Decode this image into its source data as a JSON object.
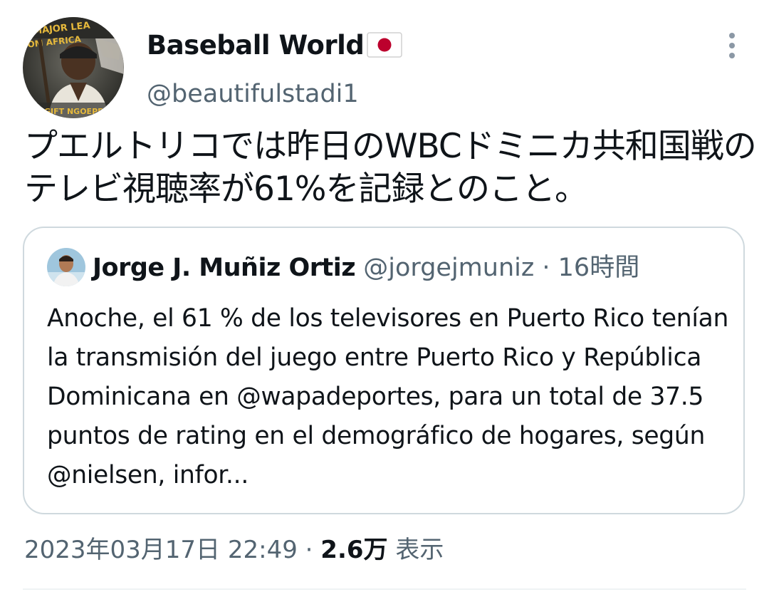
{
  "tweet": {
    "author": {
      "display_name": "Baseball World",
      "flag_icon": "japan-flag-icon",
      "handle": "@beautifulstadi1",
      "avatar_icon": "baseball-player-avatar"
    },
    "text": "プエルトリコでは昨日のWBCドミニカ共和国戦のテレビ視聴率が61%を記録とのこと。",
    "timestamp": "2023年03月17日 22:49",
    "separator": "·",
    "views_count": "2.6万",
    "views_label": "表示"
  },
  "quoted_tweet": {
    "display_name": "Jorge J. Muñiz Ortiz",
    "handle": "@jorgejmuniz",
    "separator": "·",
    "time_ago": "16時間",
    "text": "Anoche, el 61 % de los televisores en Puerto Rico tenían la transmisión del juego entre Puerto Rico y República Dominicana en @wapadeportes, para un total de 37.5 puntos de rating en el demográfico de hogares, según @nielsen, infor..."
  },
  "colors": {
    "text_primary": "#0f1419",
    "text_secondary": "#536471",
    "border": "#cfd9de",
    "flag_red": "#bc002d"
  }
}
